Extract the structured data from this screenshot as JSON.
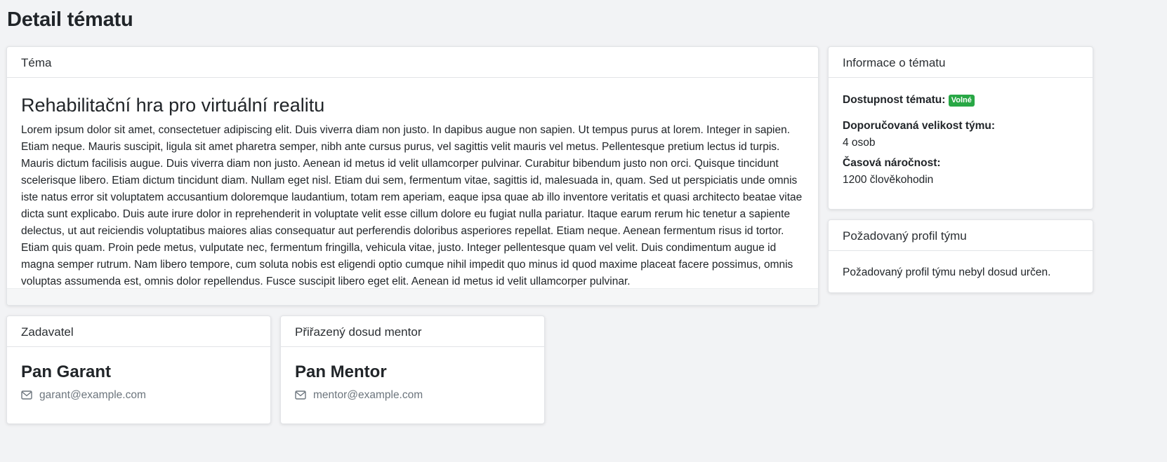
{
  "page": {
    "title": "Detail tématu"
  },
  "topic_card": {
    "header": "Téma",
    "title": "Rehabilitační hra pro virtuální realitu",
    "description": "Lorem ipsum dolor sit amet, consectetuer adipiscing elit. Duis viverra diam non justo. In dapibus augue non sapien. Ut tempus purus at lorem. Integer in sapien. Etiam neque. Mauris suscipit, ligula sit amet pharetra semper, nibh ante cursus purus, vel sagittis velit mauris vel metus. Pellentesque pretium lectus id turpis. Mauris dictum facilisis augue. Duis viverra diam non justo. Aenean id metus id velit ullamcorper pulvinar. Curabitur bibendum justo non orci. Quisque tincidunt scelerisque libero. Etiam dictum tincidunt diam. Nullam eget nisl. Etiam dui sem, fermentum vitae, sagittis id, malesuada in, quam. Sed ut perspiciatis unde omnis iste natus error sit voluptatem accusantium doloremque laudantium, totam rem aperiam, eaque ipsa quae ab illo inventore veritatis et quasi architecto beatae vitae dicta sunt explicabo. Duis aute irure dolor in reprehenderit in voluptate velit esse cillum dolore eu fugiat nulla pariatur. Itaque earum rerum hic tenetur a sapiente delectus, ut aut reiciendis voluptatibus maiores alias consequatur aut perferendis doloribus asperiores repellat. Etiam neque. Aenean fermentum risus id tortor. Etiam quis quam. Proin pede metus, vulputate nec, fermentum fringilla, vehicula vitae, justo. Integer pellentesque quam vel velit. Duis condimentum augue id magna semper rutrum. Nam libero tempore, cum soluta nobis est eligendi optio cumque nihil impedit quo minus id quod maxime placeat facere possimus, omnis voluptas assumenda est, omnis dolor repellendus. Fusce suscipit libero eget elit. Aenean id metus id velit ullamcorper pulvinar."
  },
  "info_card": {
    "header": "Informace o tématu",
    "availability_label": "Dostupnost tématu:",
    "availability_badge": "Volné",
    "team_size_label": "Doporučovaná velikost týmu:",
    "team_size_value": "4 osob",
    "time_label": "Časová náročnost:",
    "time_value": "1200 člověkohodin"
  },
  "profile_card": {
    "header": "Požadovaný profil týmu",
    "text": "Požadovaný profil týmu nebyl dosud určen."
  },
  "submitter_card": {
    "header": "Zadavatel",
    "name": "Pan Garant",
    "email": "garant@example.com"
  },
  "mentor_card": {
    "header": "Přiřazený dosud mentor",
    "name": "Pan Mentor",
    "email": "mentor@example.com"
  },
  "colors": {
    "background": "#f2f3f5",
    "badge_green": "#28a745",
    "muted_text": "#6c757d"
  },
  "icons": {
    "email": "envelope-icon"
  }
}
